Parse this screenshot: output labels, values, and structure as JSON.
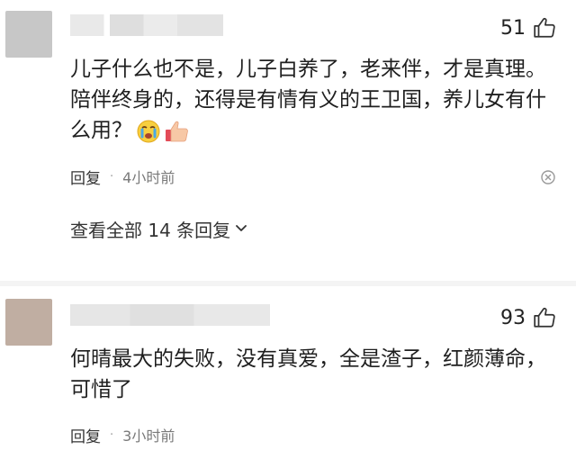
{
  "comments": [
    {
      "likes": "51",
      "text": "儿子什么也不是，儿子白养了，老来伴，才是真理。陪伴终身的，还得是有情有义的王卫国，养儿女有什么用？",
      "emojis": [
        "crying-face-icon",
        "thumbs-up-emoji-icon"
      ],
      "reply_label": "回复",
      "dot": "·",
      "time": "4小时前",
      "view_all": "查看全部 14 条回复"
    },
    {
      "likes": "93",
      "text": "何晴最大的失败，没有真爱，全是渣子，红颜薄命，可惜了",
      "reply_label": "回复",
      "dot": "·",
      "time": "3小时前"
    }
  ],
  "colors": {
    "text": "#1f1f1f",
    "meta": "#7a7a7a",
    "divider": "#f4f4f4"
  }
}
